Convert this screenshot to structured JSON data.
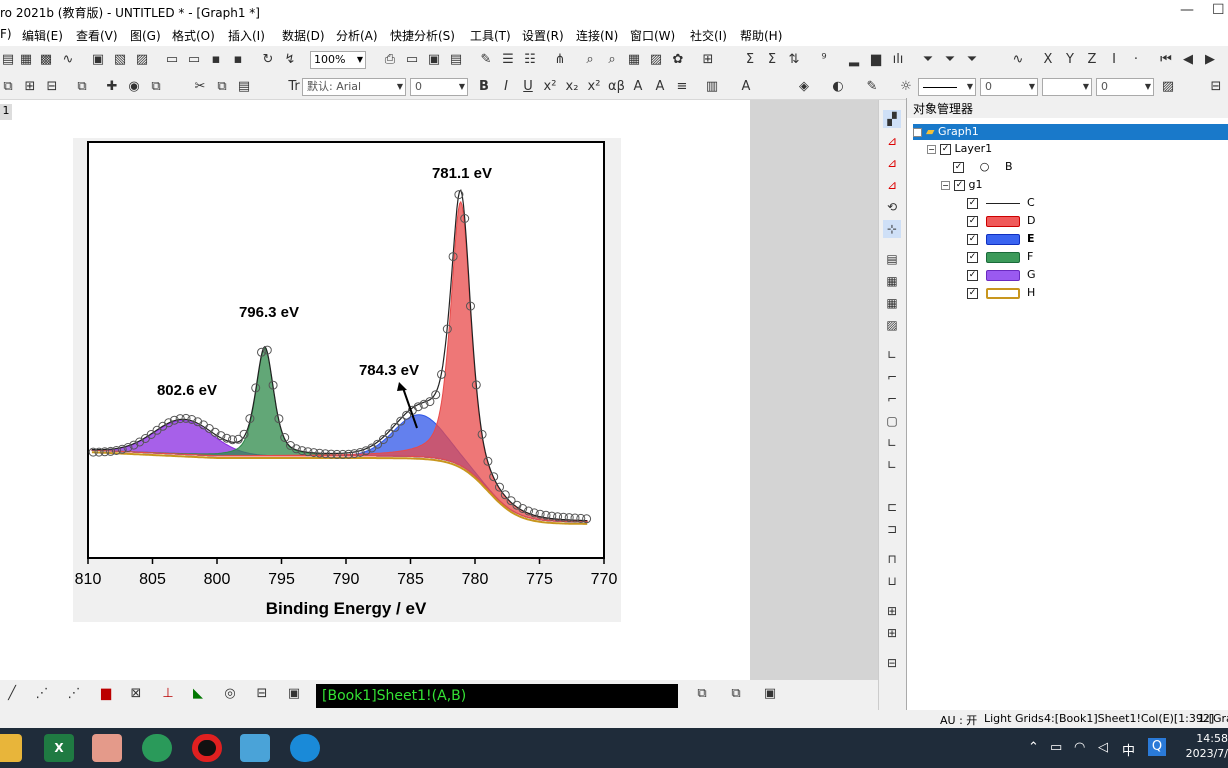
{
  "window": {
    "title": "ro 2021b (教育版) - UNTITLED * - [Graph1 *]",
    "minimize": "—",
    "maximize": "☐"
  },
  "menu": [
    "F)",
    "编辑(E)",
    "查看(V)",
    "图(G)",
    "格式(O)",
    "插入(I)",
    "数据(D)",
    "分析(A)",
    "快捷分析(S)",
    "工具(T)",
    "设置(R)",
    "连接(N)",
    "窗口(W)",
    "社交(I)",
    "帮助(H)"
  ],
  "toolbar": {
    "zoom": "100%",
    "font": "默认: Arial",
    "font_size": "0",
    "line_width": "0",
    "alpha": "0"
  },
  "graph": {
    "tab": "1",
    "chart_data": {
      "type": "line",
      "xlabel": "Binding Energy / eV",
      "xlim": [
        810,
        770
      ],
      "x_ticks": [
        "810",
        "805",
        "800",
        "795",
        "790",
        "785",
        "780",
        "775",
        "770"
      ],
      "annotations": [
        {
          "text": "781.1 eV",
          "x": 781.1
        },
        {
          "text": "796.3 eV",
          "x": 796.3
        },
        {
          "text": "802.6 eV",
          "x": 802.6
        },
        {
          "text": "784.3 eV",
          "x": 784.3
        }
      ],
      "series": [
        {
          "name": "B",
          "style": "open circles",
          "color": "#555555"
        },
        {
          "name": "C",
          "style": "line",
          "color": "#222222"
        },
        {
          "name": "D",
          "style": "fill",
          "color": "#e84a4a",
          "peak": 781.1
        },
        {
          "name": "E",
          "style": "fill",
          "color": "#2f56e8",
          "peak": 784.3
        },
        {
          "name": "F",
          "style": "fill",
          "color": "#2e8a4a",
          "peak": 796.3
        },
        {
          "name": "G",
          "style": "fill",
          "color": "#8a2be2",
          "peak": 802.6
        },
        {
          "name": "H",
          "style": "line",
          "color": "#c8961e"
        }
      ]
    }
  },
  "object_manager": {
    "title": "对象管理器",
    "graph": "Graph1",
    "layer": "Layer1",
    "group": "g1",
    "items": [
      {
        "label": "B",
        "kind": "circle",
        "color": "#444444"
      },
      {
        "label": "C",
        "kind": "line",
        "color": "#222222"
      },
      {
        "label": "D",
        "kind": "fill",
        "color": "#f05a5a"
      },
      {
        "label": "E",
        "kind": "fill",
        "color": "#3a64f0"
      },
      {
        "label": "F",
        "kind": "fill",
        "color": "#3c9a5a"
      },
      {
        "label": "G",
        "kind": "fill",
        "color": "#9a5af0"
      },
      {
        "label": "H",
        "kind": "outline",
        "color": "#c8961e"
      }
    ]
  },
  "command": "[Book1]Sheet1!(A,B)",
  "status": {
    "au": "AU : 开",
    "grids": "Light Grids",
    "col": "4:[Book1]Sheet1!Col(E)[1:392]",
    "layer": "1:[Gra"
  },
  "taskbar": {
    "time": "14:58",
    "date": "2023/7/",
    "lang": "中"
  }
}
